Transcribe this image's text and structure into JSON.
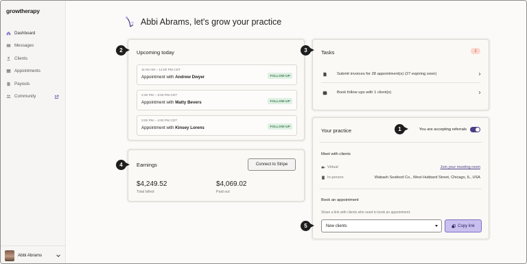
{
  "app": {
    "logo": "growtherapy"
  },
  "sidebar": {
    "items": [
      {
        "label": "Dashboard",
        "icon": "home-icon",
        "active": true
      },
      {
        "label": "Messages",
        "icon": "message-icon"
      },
      {
        "label": "Clients",
        "icon": "person-icon"
      },
      {
        "label": "Appointments",
        "icon": "calendar-icon"
      },
      {
        "label": "Payouts",
        "icon": "document-icon"
      },
      {
        "label": "Community",
        "icon": "people-icon",
        "external": true
      }
    ],
    "user": {
      "name": "Abbi Abrams"
    }
  },
  "header": {
    "title": "Abbi Abrams, let's grow your practice"
  },
  "callouts": [
    "1",
    "2",
    "3",
    "4",
    "5"
  ],
  "upcoming": {
    "title": "Upcoming today",
    "appointments": [
      {
        "time": "11:00 AM – 12:00 PM CDT",
        "prefix": "Appointment with ",
        "client": "Andrew Dwyer",
        "badge": "FOLLOW-UP"
      },
      {
        "time": "2:00 PM – 3:00 PM CDT",
        "prefix": "Appointment with ",
        "client": "Matty Bevers",
        "badge": "FOLLOW-UP"
      },
      {
        "time": "3:00 PM – 4:00 PM CDT",
        "prefix": "Appointment with ",
        "client": "Kinsey Lorens",
        "badge": "FOLLOW-UP"
      }
    ]
  },
  "earnings": {
    "title": "Earnings",
    "connect_label": "Connect to Stripe",
    "total_billed": "$4,249.52",
    "total_billed_label": "Total billed",
    "paid_out": "$4,069.02",
    "paid_out_label": "Paid out"
  },
  "tasks": {
    "title": "Tasks",
    "count": "2",
    "items": [
      {
        "label": "Submit invoices for 28 appointment(s) (27 expiring soon)"
      },
      {
        "label": "Book follow ups with 1 client(s)"
      }
    ]
  },
  "practice": {
    "title": "Your practice",
    "accepting_label": "You are accepting referrals",
    "accepting": true,
    "meet_title": "Meet with clients",
    "virtual_label": "Virtual",
    "virtual_link": "Join your meeting room",
    "inperson_label": "In-person",
    "inperson_address": "Wabash Seafood Co., West Hubbard Street, Chicago, IL, USA",
    "book_title": "Book an appointment",
    "book_hint": "Share a link with clients who need to book an appointment:",
    "select_value": "New clients",
    "copy_label": "Copy link"
  },
  "colors": {
    "accent": "#4a3f86",
    "badge_green": "#3b7c52",
    "task_badge": "#c0472e"
  }
}
